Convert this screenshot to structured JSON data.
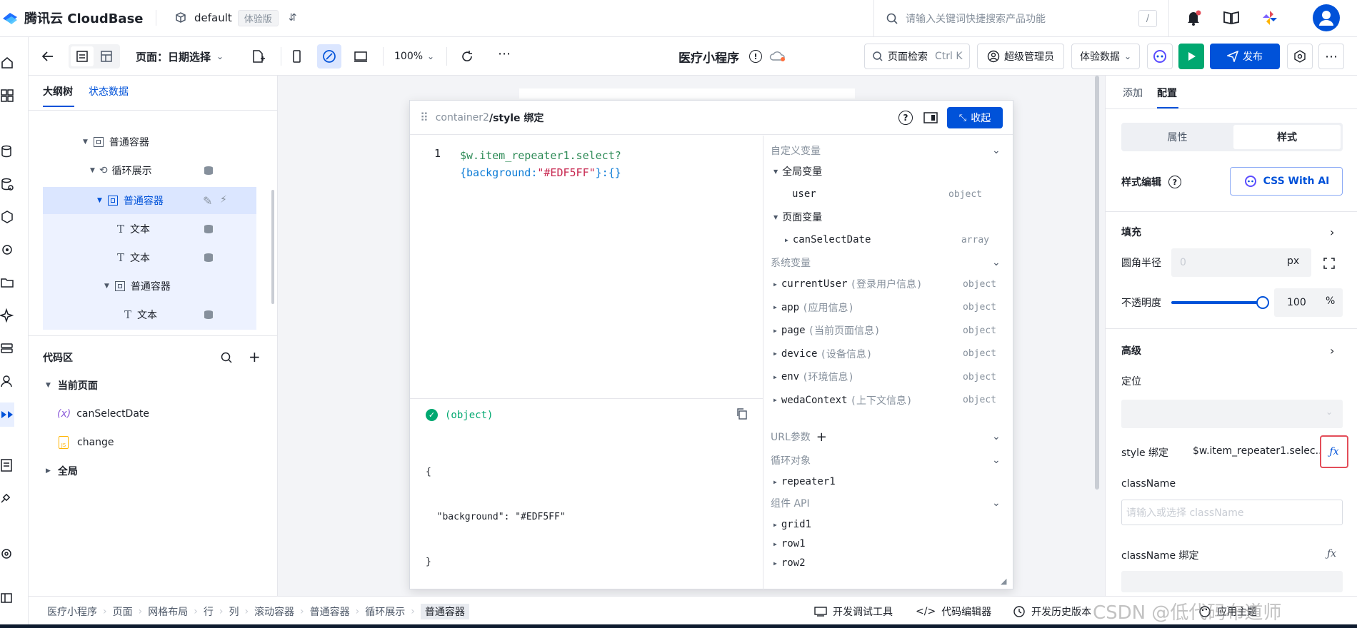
{
  "topbar": {
    "brand": "腾讯云 CloudBase",
    "env_name": "default",
    "env_badge": "体验版",
    "search_placeholder": "请输入关键词快捷搜索产品功能",
    "search_shortcut": "/"
  },
  "toolbar": {
    "page_label": "页面：日期选择",
    "zoom": "100%",
    "app_title": "医疗小程序",
    "page_search": "页面检索",
    "page_search_shortcut": "Ctrl K",
    "admin": "超级管理员",
    "data_mode": "体验数据",
    "publish": "发布"
  },
  "left_panel": {
    "tabs": [
      "大纲树",
      "状态数据"
    ],
    "tree": [
      {
        "label": "普通容器",
        "icon": "container-icon"
      },
      {
        "label": "循环展示",
        "icon": "loop-icon"
      },
      {
        "label": "普通容器",
        "icon": "container-icon"
      },
      {
        "label": "文本",
        "icon": "text-icon"
      },
      {
        "label": "文本",
        "icon": "text-icon"
      },
      {
        "label": "普通容器",
        "icon": "container-icon"
      },
      {
        "label": "文本",
        "icon": "text-icon"
      }
    ],
    "code_title": "代码区",
    "code_tree": {
      "current_page": "当前页面",
      "items": [
        "canSelectDate",
        "change"
      ],
      "global": "全局"
    }
  },
  "binding_dialog": {
    "path_prefix": "container2",
    "path_suffix": "/style 绑定",
    "collapse": "收起",
    "line_number": "1",
    "code_line1": "$w.item_repeater1.select?",
    "code_line2_a": "{background:",
    "code_line2_str": "\"#EDF5FF\"",
    "code_line2_b": "}:{}",
    "result_type": "(object)",
    "result_lines": [
      "{",
      "  \"background\": \"#EDF5FF\"",
      "}"
    ],
    "vars": {
      "custom_title": "自定义变量",
      "global_title": "全局变量",
      "user": "user",
      "user_type": "object",
      "page_title": "页面变量",
      "canSelectDate": "canSelectDate",
      "canSelectDate_type": "array",
      "system_title": "系统变量",
      "system": [
        {
          "name": "currentUser",
          "desc": "(登录用户信息)",
          "type": "object"
        },
        {
          "name": "app",
          "desc": "(应用信息)",
          "type": "object"
        },
        {
          "name": "page",
          "desc": "(当前页面信息)",
          "type": "object"
        },
        {
          "name": "device",
          "desc": "(设备信息)",
          "type": "object"
        },
        {
          "name": "env",
          "desc": "(环境信息)",
          "type": "object"
        },
        {
          "name": "wedaContext",
          "desc": "(上下文信息)",
          "type": "object"
        }
      ],
      "url_title": "URL参数",
      "loop_title": "循环对象",
      "repeater": "repeater1",
      "api_title": "组件 API",
      "apis": [
        "grid1",
        "row1",
        "row2"
      ]
    }
  },
  "right_panel": {
    "tabs": [
      "添加",
      "配置"
    ],
    "seg": [
      "属性",
      "样式"
    ],
    "style_edit": "样式编辑",
    "css_ai": "CSS With AI",
    "fill": "填充",
    "radius_label": "圆角半径",
    "radius_placeholder": "0",
    "radius_unit": "px",
    "opacity_label": "不透明度",
    "opacity_value": "100",
    "opacity_unit": "%",
    "opacity_level": 1.0,
    "advanced": "高级",
    "position": "定位",
    "style_binding_label": "style 绑定",
    "style_binding_value": "$w.item_repeater1.selec...",
    "classname": "className",
    "classname_placeholder": "请输入或选择 className",
    "classname_binding": "className 绑定"
  },
  "statusbar": {
    "breadcrumb": [
      "医疗小程序",
      "页面",
      "网格布局",
      "行",
      "列",
      "滚动容器",
      "普通容器",
      "循环展示",
      "普通容器"
    ],
    "dev_tools": "开发调试工具",
    "code_editor": "代码编辑器",
    "history": "开发历史版本",
    "theme": "应用主题"
  },
  "watermark": "CSDN @低代码布道师",
  "colors": {
    "accent": "#0052d9",
    "green": "#00a870",
    "string": "#c7254e",
    "code_blue": "#0b7bd6",
    "code_green": "#2e8b57"
  }
}
